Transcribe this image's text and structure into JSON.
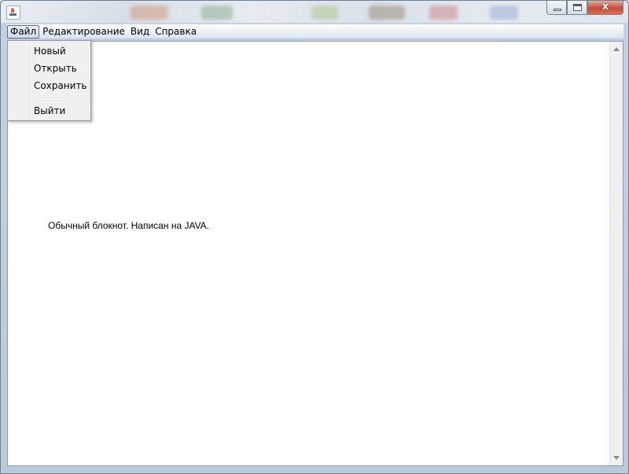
{
  "menubar": {
    "items": [
      {
        "label": "Файл"
      },
      {
        "label": "Редактирование"
      },
      {
        "label": "Вид"
      },
      {
        "label": "Справка"
      }
    ]
  },
  "file_menu": {
    "items": [
      "Новый",
      "Открыть",
      "Сохранить",
      "Выйти"
    ]
  },
  "document": {
    "text": "Обычный блокнот. Написан на JAVA."
  },
  "window_controls": {
    "close_glyph": "x"
  },
  "colors": {
    "close_button": "#c8432b",
    "menu_background": "#f0f0f0",
    "editor_background": "#ffffff"
  }
}
